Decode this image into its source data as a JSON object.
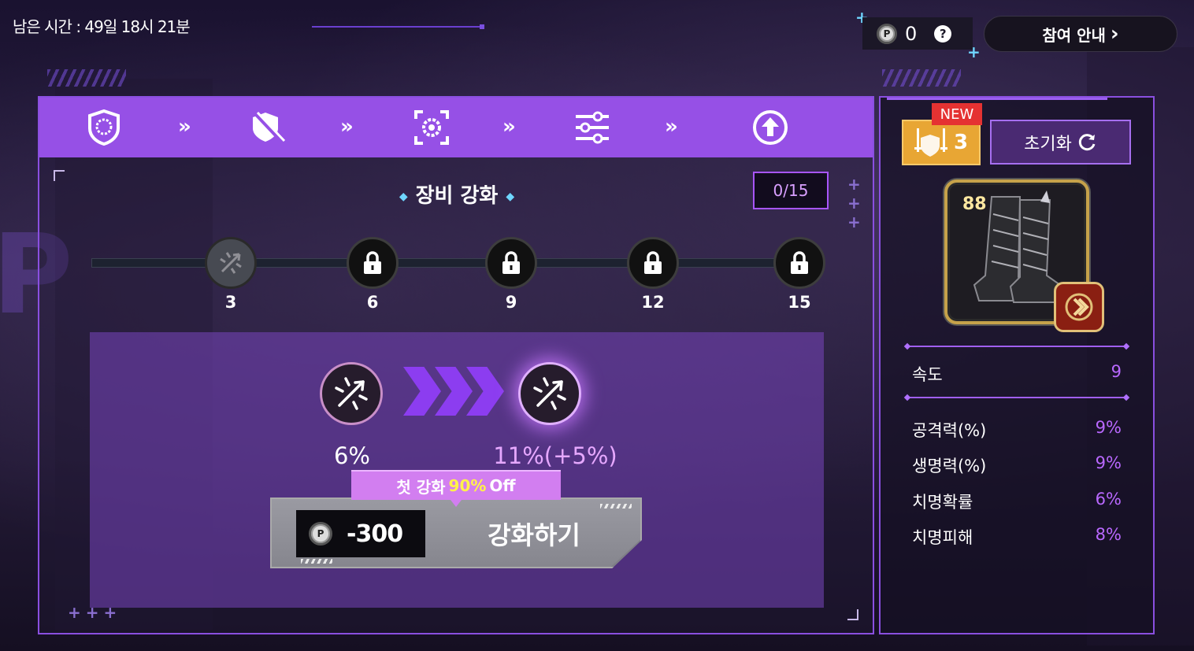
{
  "header": {
    "time_left": "남은 시간 : 49일 18시 21분",
    "points_value": "0",
    "help_symbol": "?",
    "guide_label": "참여 안내",
    "guide_chevron": "›"
  },
  "steps": {
    "icons": [
      "shield-ring-icon",
      "shield-sword-icon",
      "focus-gear-icon",
      "sliders-icon",
      "upgrade-arrow-icon"
    ],
    "separator": "»"
  },
  "enhance": {
    "title": "장비 강화",
    "progress": "0/15",
    "progress_current": 0,
    "progress_max": 15,
    "milestones": [
      "3",
      "6",
      "9",
      "12",
      "15"
    ],
    "current_value": "6%",
    "next_value": "11%(+5%)",
    "discount_prefix": "첫 강화",
    "discount_highlight": "90%",
    "discount_suffix": "Off",
    "cost": "-300",
    "button_label": "강화하기"
  },
  "side": {
    "new_tag": "NEW",
    "level_badge": "3",
    "reset_label": "초기화",
    "item_level": "88",
    "primary_stat": {
      "label": "속도",
      "value": "9"
    },
    "stats": [
      {
        "label": "공격력(%)",
        "value": "9%"
      },
      {
        "label": "생명력(%)",
        "value": "9%"
      },
      {
        "label": "치명확률",
        "value": "6%"
      },
      {
        "label": "치명피해",
        "value": "8%"
      }
    ]
  },
  "colors": {
    "accent_purple": "#9650e6",
    "stat_value": "#b968ff",
    "highlight_yellow": "#fff24a",
    "badge_orange": "#e8a634",
    "new_red": "#e53232"
  }
}
